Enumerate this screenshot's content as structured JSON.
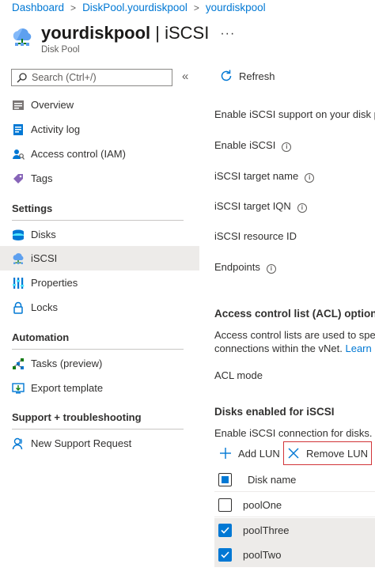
{
  "breadcrumb": [
    "Dashboard",
    "DiskPool.yourdiskpool",
    "yourdiskpool"
  ],
  "header": {
    "title_name": "yourdiskpool",
    "title_separator": " | ",
    "title_section": "iSCSI",
    "subtitle": "Disk Pool",
    "more": "···"
  },
  "search": {
    "placeholder": "Search (Ctrl+/)"
  },
  "collapse_glyph": "«",
  "nav": {
    "top": [
      {
        "label": "Overview",
        "icon": "overview-icon"
      },
      {
        "label": "Activity log",
        "icon": "activity-log-icon"
      },
      {
        "label": "Access control (IAM)",
        "icon": "iam-icon"
      },
      {
        "label": "Tags",
        "icon": "tag-icon"
      }
    ],
    "settings_header": "Settings",
    "settings": [
      {
        "label": "Disks",
        "icon": "disks-icon"
      },
      {
        "label": "iSCSI",
        "icon": "iscsi-icon",
        "selected": true
      },
      {
        "label": "Properties",
        "icon": "properties-icon"
      },
      {
        "label": "Locks",
        "icon": "lock-icon"
      }
    ],
    "automation_header": "Automation",
    "automation": [
      {
        "label": "Tasks (preview)",
        "icon": "tasks-icon"
      },
      {
        "label": "Export template",
        "icon": "export-template-icon"
      }
    ],
    "support_header": "Support + troubleshooting",
    "support": [
      {
        "label": "New Support Request",
        "icon": "support-icon"
      }
    ]
  },
  "content": {
    "refresh_label": "Refresh",
    "enable_text": "Enable iSCSI support on your disk pool",
    "fields": [
      "Enable iSCSI",
      "iSCSI target name",
      "iSCSI target IQN",
      "iSCSI resource ID",
      "Endpoints"
    ],
    "acl_heading": "Access control list (ACL) options",
    "acl_desc_1": "Access control lists are used to specify",
    "acl_desc_2": "connections within the vNet. ",
    "acl_learn_more": "Learn more",
    "acl_mode": "ACL mode",
    "disks_heading": "Disks enabled for iSCSI",
    "disks_desc": "Enable iSCSI connection for disks. To",
    "add_lun": "Add LUN",
    "remove_lun": "Remove LUN",
    "column_disk_name": "Disk name",
    "rows": [
      {
        "name": "poolOne",
        "checked": false
      },
      {
        "name": "poolThree",
        "checked": true
      },
      {
        "name": "poolTwo",
        "checked": true
      }
    ]
  },
  "colors": {
    "accent": "#0078d4",
    "highlight_border": "#d13438",
    "selected_bg": "#edebe9"
  }
}
